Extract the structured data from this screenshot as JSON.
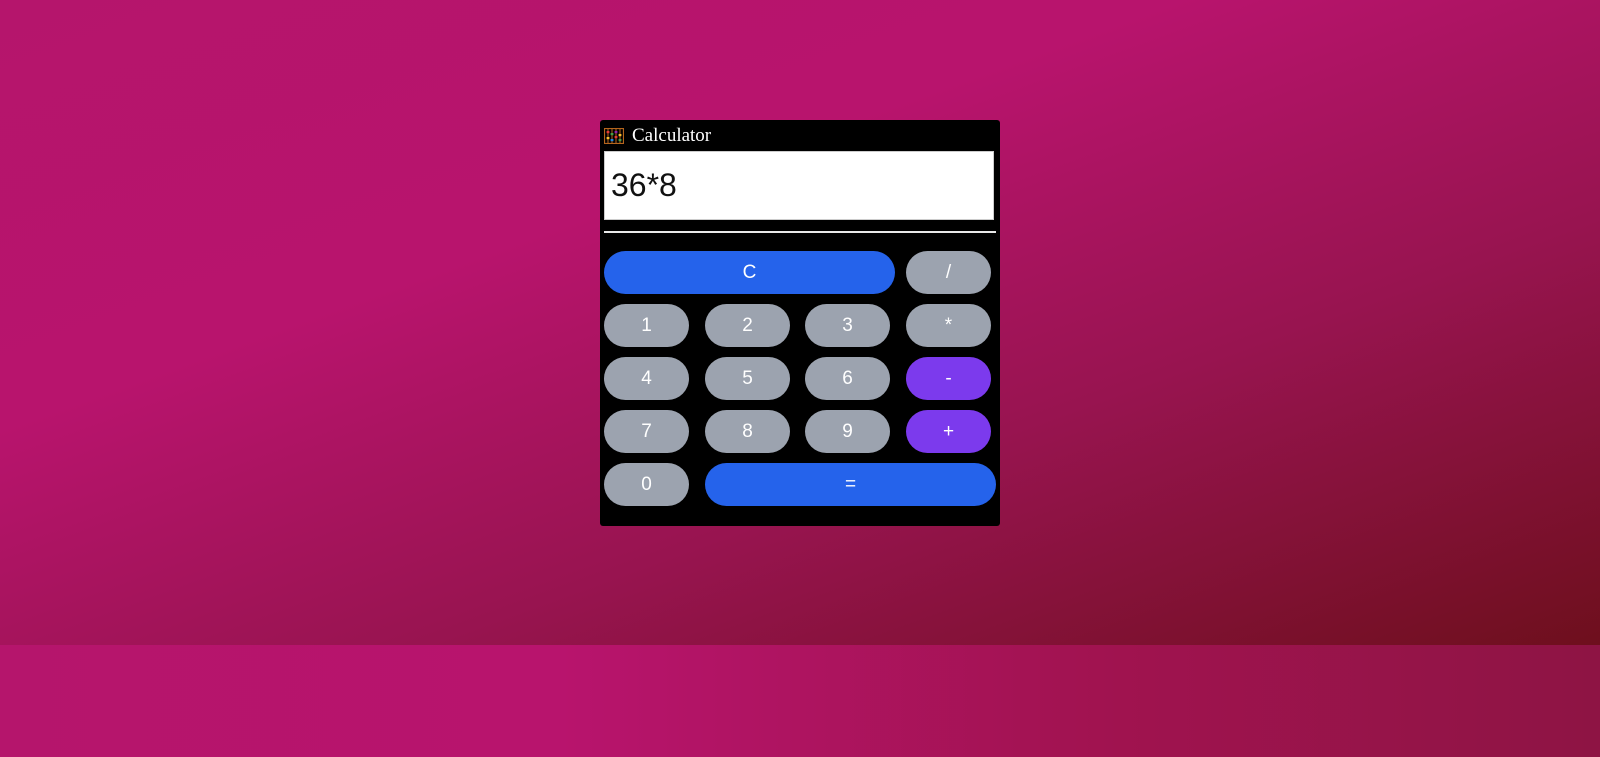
{
  "app": {
    "title": "Calculator",
    "icon": "abacus-icon"
  },
  "display": {
    "value": "36*8"
  },
  "buttons": {
    "clear": "C",
    "divide": "/",
    "one": "1",
    "two": "2",
    "three": "3",
    "multiply": "*",
    "four": "4",
    "five": "5",
    "six": "6",
    "subtract": "-",
    "seven": "7",
    "eight": "8",
    "nine": "9",
    "add": "+",
    "zero": "0",
    "equals": "="
  },
  "colors": {
    "background_gradient": [
      "#b8146d",
      "#6e0f1d"
    ],
    "panel": "#000000",
    "digit_button": "#9ca3af",
    "clear_equals_button": "#2563eb",
    "operator_accent_button": "#7c3aed",
    "button_text": "#ffffff"
  }
}
